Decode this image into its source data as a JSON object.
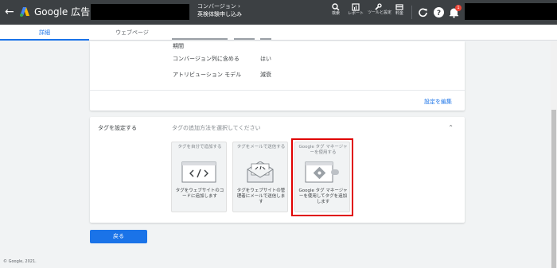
{
  "header": {
    "brand": "Google 広告",
    "breadcrumb_parent": "コンバージョン ›",
    "breadcrumb_current": "英検体験申し込み",
    "tools": [
      {
        "label": "検索",
        "icon": "search-icon"
      },
      {
        "label": "レポート",
        "icon": "reports-icon"
      },
      {
        "label": "ツールと設定",
        "icon": "tools-icon"
      },
      {
        "label": "料金",
        "icon": "billing-icon"
      }
    ],
    "notification_count": "1"
  },
  "tabs": [
    {
      "label": "詳細"
    },
    {
      "label": "ウェブページ"
    }
  ],
  "settings": {
    "rows": [
      {
        "label": "期間",
        "value": ""
      },
      {
        "label": "コンバージョン列に含める",
        "value": "はい"
      },
      {
        "label": "アトリビューション モデル",
        "value": "減衰"
      }
    ],
    "edit_link": "設定を編集"
  },
  "tag_setup": {
    "title": "タグを設定する",
    "subtitle": "タグの追加方法を選択してください",
    "options": [
      {
        "title": "タグを自分で追加する",
        "desc": "タグをウェブサイトのコードに追加します",
        "icon": "code-window-icon"
      },
      {
        "title": "タグをメールで送信する",
        "desc": "タグをウェブサイトの管理者にメールで送信します",
        "icon": "email-code-icon"
      },
      {
        "title": "Google タグ マネージャーを使用する",
        "desc": "Google タグ マネージャーを使用してタグを追加します",
        "icon": "tag-manager-icon"
      }
    ]
  },
  "back_button": "戻る",
  "footer": "© Google, 2021.",
  "colors": {
    "accent": "#1a73e8",
    "topbar": "#3c4043",
    "highlight": "#e00000"
  }
}
